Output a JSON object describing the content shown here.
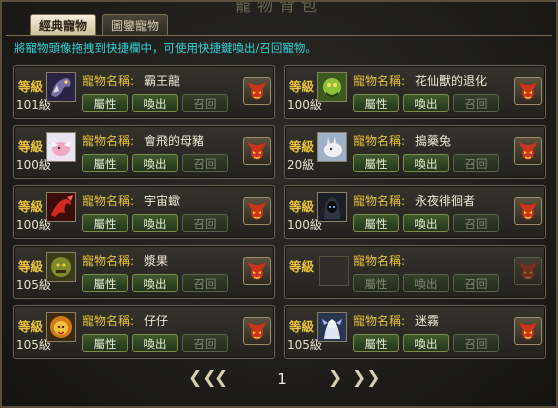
{
  "window": {
    "title": "寵物背包"
  },
  "tabs": [
    {
      "label": "經典寵物",
      "active": true
    },
    {
      "label": "圖鑒寵物",
      "active": false
    }
  ],
  "hint": "將寵物頭像拖拽到快捷欄中，可使用快捷鍵喚出/召回寵物。",
  "labels": {
    "level": "等級",
    "name": "寵物名稱:",
    "attr_button": "屬性",
    "summon_button": "喚出",
    "recall_button": "召回"
  },
  "pets": [
    {
      "name": "霸王龍",
      "level": "101級",
      "avatar": "dragon-dark"
    },
    {
      "name": "花仙獸的退化",
      "level": "100級",
      "avatar": "flower-beast"
    },
    {
      "name": "會飛的母豬",
      "level": "100級",
      "avatar": "flying-pig"
    },
    {
      "name": "搗藥兔",
      "level": "20級",
      "avatar": "rabbit"
    },
    {
      "name": "宇宙蠍",
      "level": "100級",
      "avatar": "scorpion-red"
    },
    {
      "name": "永夜徘徊者",
      "level": "100級",
      "avatar": "hooded-wanderer"
    },
    {
      "name": "漿果",
      "level": "105級",
      "avatar": "berry-ogre"
    },
    {
      "name": "",
      "level": "",
      "avatar": "empty"
    },
    {
      "name": "仔仔",
      "level": "105級",
      "avatar": "golden-lion"
    },
    {
      "name": "迷霧",
      "level": "105級",
      "avatar": "mist-spirit"
    }
  ],
  "pager": {
    "page": "1"
  },
  "colors": {
    "hint": "#2fd5d8",
    "label": "#e9c23a",
    "button_green": "#3f5a2c"
  }
}
